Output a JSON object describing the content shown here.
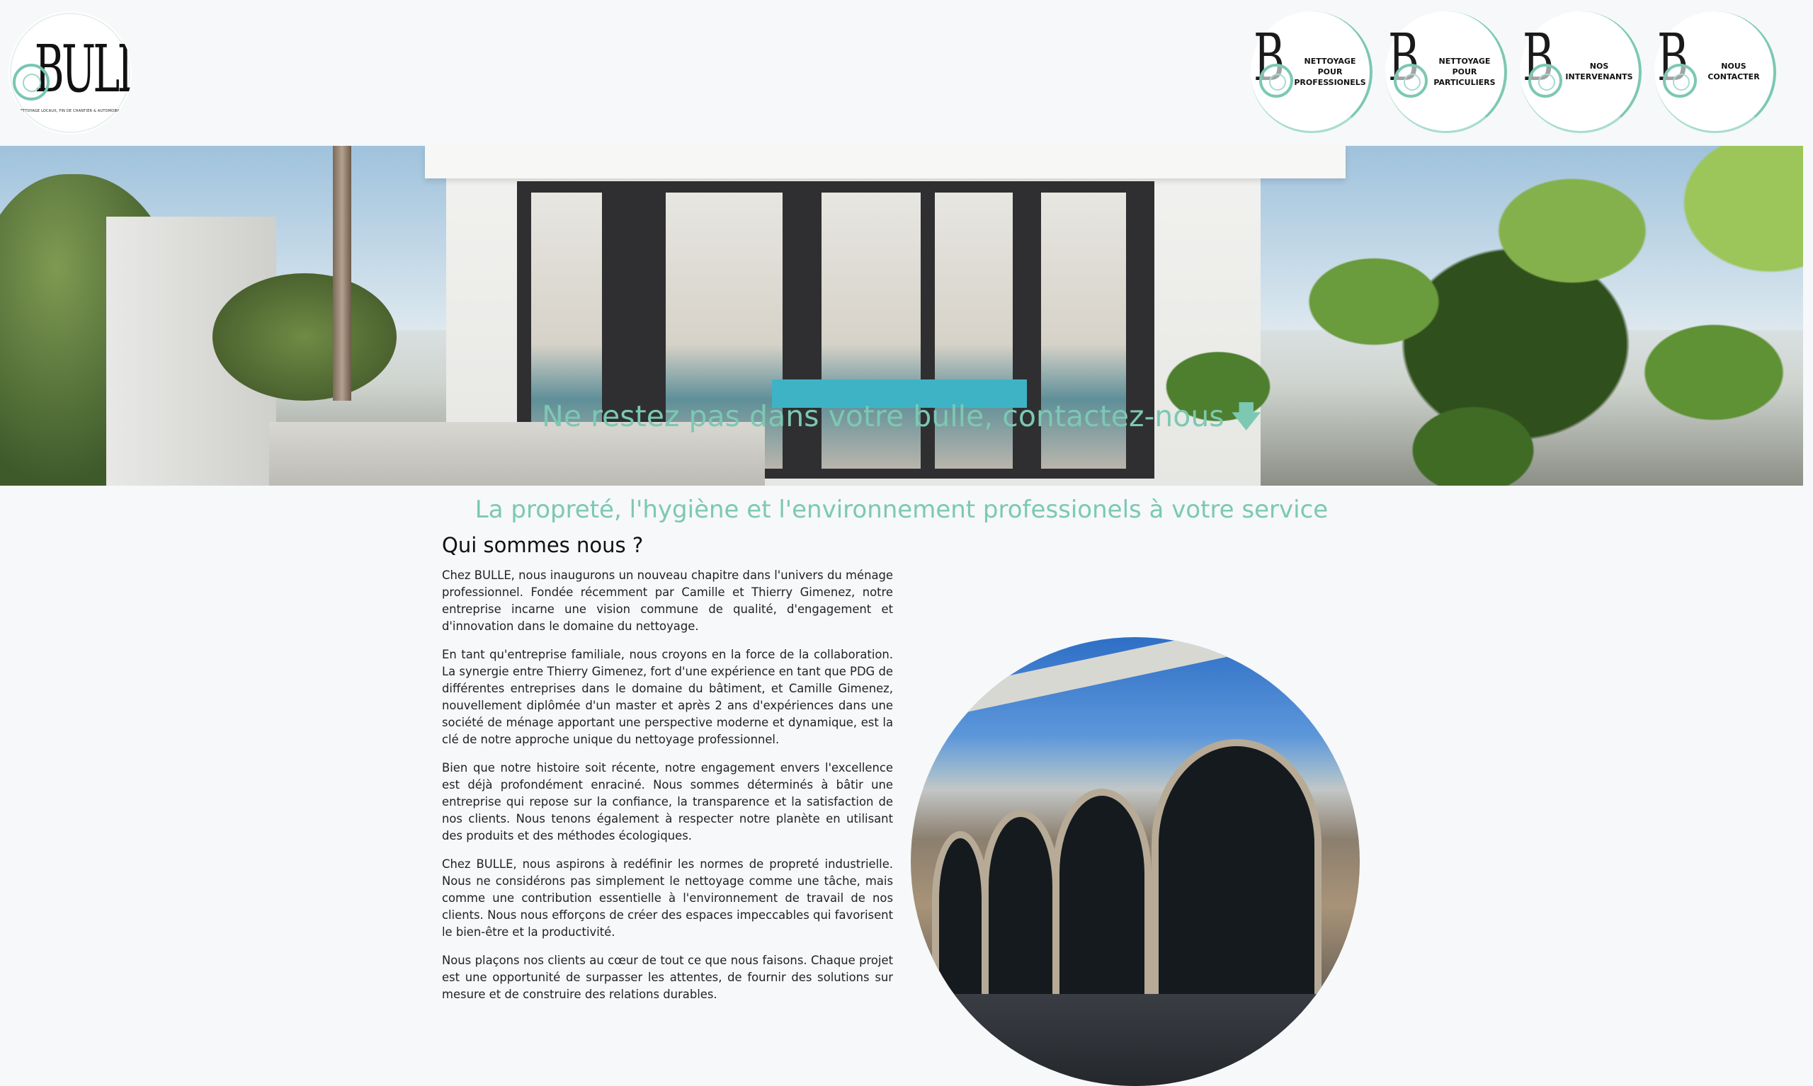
{
  "brand": {
    "logo_word": "BULLE",
    "logo_tagline": "NETTOYAGE LOCAUX, FIN DE CHANTIER & AUTOMOBILE",
    "nav_logo_letter": "B"
  },
  "nav": {
    "items": [
      {
        "label": "NETTOYAGE POUR PROFESSIONELS"
      },
      {
        "label": "NETTOYAGE POUR PARTICULIERS"
      },
      {
        "label": "NOS INTERVENANTS"
      },
      {
        "label": "NOUS CONTACTER"
      }
    ]
  },
  "hero": {
    "cta": "Ne restez pas dans votre bulle, contactez-nous",
    "cta_arrow": "🡇"
  },
  "main": {
    "tagline": "La propreté, l'hygiène et l'environnement professionels à votre service",
    "heading": "Qui sommes nous ?",
    "paragraphs": [
      "Chez BULLE, nous inaugurons un nouveau chapitre dans l'univers du ménage professionnel. Fondée récemment par Camille et Thierry Gimenez, notre entreprise incarne une vision commune de qualité, d'engagement et d'innovation dans le domaine du nettoyage.",
      "En tant qu'entreprise familiale, nous croyons en la force de la collaboration. La synergie entre Thierry Gimenez, fort d'une expérience en tant que PDG de différentes entreprises dans le domaine du bâtiment, et Camille Gimenez, nouvellement diplômée d'un master et après 2 ans d'expériences dans une société de ménage apportant une perspective moderne et dynamique, est la clé de notre approche unique du nettoyage professionnel.",
      "Bien que notre histoire soit récente, notre engagement envers l'excellence est déjà profondément enraciné. Nous sommes déterminés à bâtir une entreprise qui repose sur la confiance, la transparence et la satisfaction de nos clients. Nous tenons également à respecter notre planète en utilisant des produits et des méthodes écologiques.",
      "Chez BULLE, nous aspirons à redéfinir les normes de propreté industrielle. Nous ne considérons pas simplement le nettoyage comme une tâche, mais comme une contribution essentielle à l'environnement de travail de nos clients. Nous nous efforçons de créer des espaces impeccables qui favorisent le bien-être et la productivité.",
      "Nous plaçons nos clients au cœur de tout ce que nous faisons. Chaque projet est une opportunité de surpasser les attentes, de fournir des solutions sur mesure et de construire des relations durables."
    ]
  },
  "colors": {
    "accent": "#7cc8b3",
    "background": "#f6f8f9",
    "text": "#222222"
  }
}
